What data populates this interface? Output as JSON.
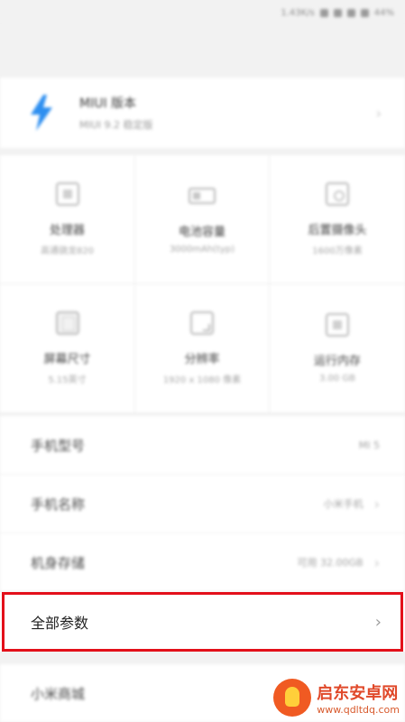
{
  "status_bar": {
    "speed": "1.43K/s",
    "battery": "44%"
  },
  "miui": {
    "title": "MIUI 版本",
    "subtitle": "MIUI 9.2 稳定版"
  },
  "grid": [
    {
      "title": "处理器",
      "sub": "高通骁龙820",
      "icon": "cpu-icon"
    },
    {
      "title": "电池容量",
      "sub": "3000mAh(typ)",
      "icon": "battery-icon"
    },
    {
      "title": "后置摄像头",
      "sub": "1600万像素",
      "icon": "camera-icon"
    },
    {
      "title": "屏幕尺寸",
      "sub": "5.15英寸",
      "icon": "screen-icon"
    },
    {
      "title": "分辨率",
      "sub": "1920 x 1080 像素",
      "icon": "resolution-icon"
    },
    {
      "title": "运行内存",
      "sub": "3.00 GB",
      "icon": "memory-icon"
    }
  ],
  "list": [
    {
      "label": "手机型号",
      "value": "MI 5",
      "chevron": false
    },
    {
      "label": "手机名称",
      "value": "小米手机",
      "chevron": true
    },
    {
      "label": "机身存储",
      "value": "可用 32.00GB",
      "chevron": true
    }
  ],
  "all_params": {
    "label": "全部参数",
    "chevron": "›"
  },
  "store": {
    "label": "小米商城"
  },
  "watermark": {
    "title": "启东安卓网",
    "url": "www.qdltdq.com"
  },
  "colors": {
    "highlight": "#e3101a",
    "miui_logo": "#2e8ff0"
  }
}
